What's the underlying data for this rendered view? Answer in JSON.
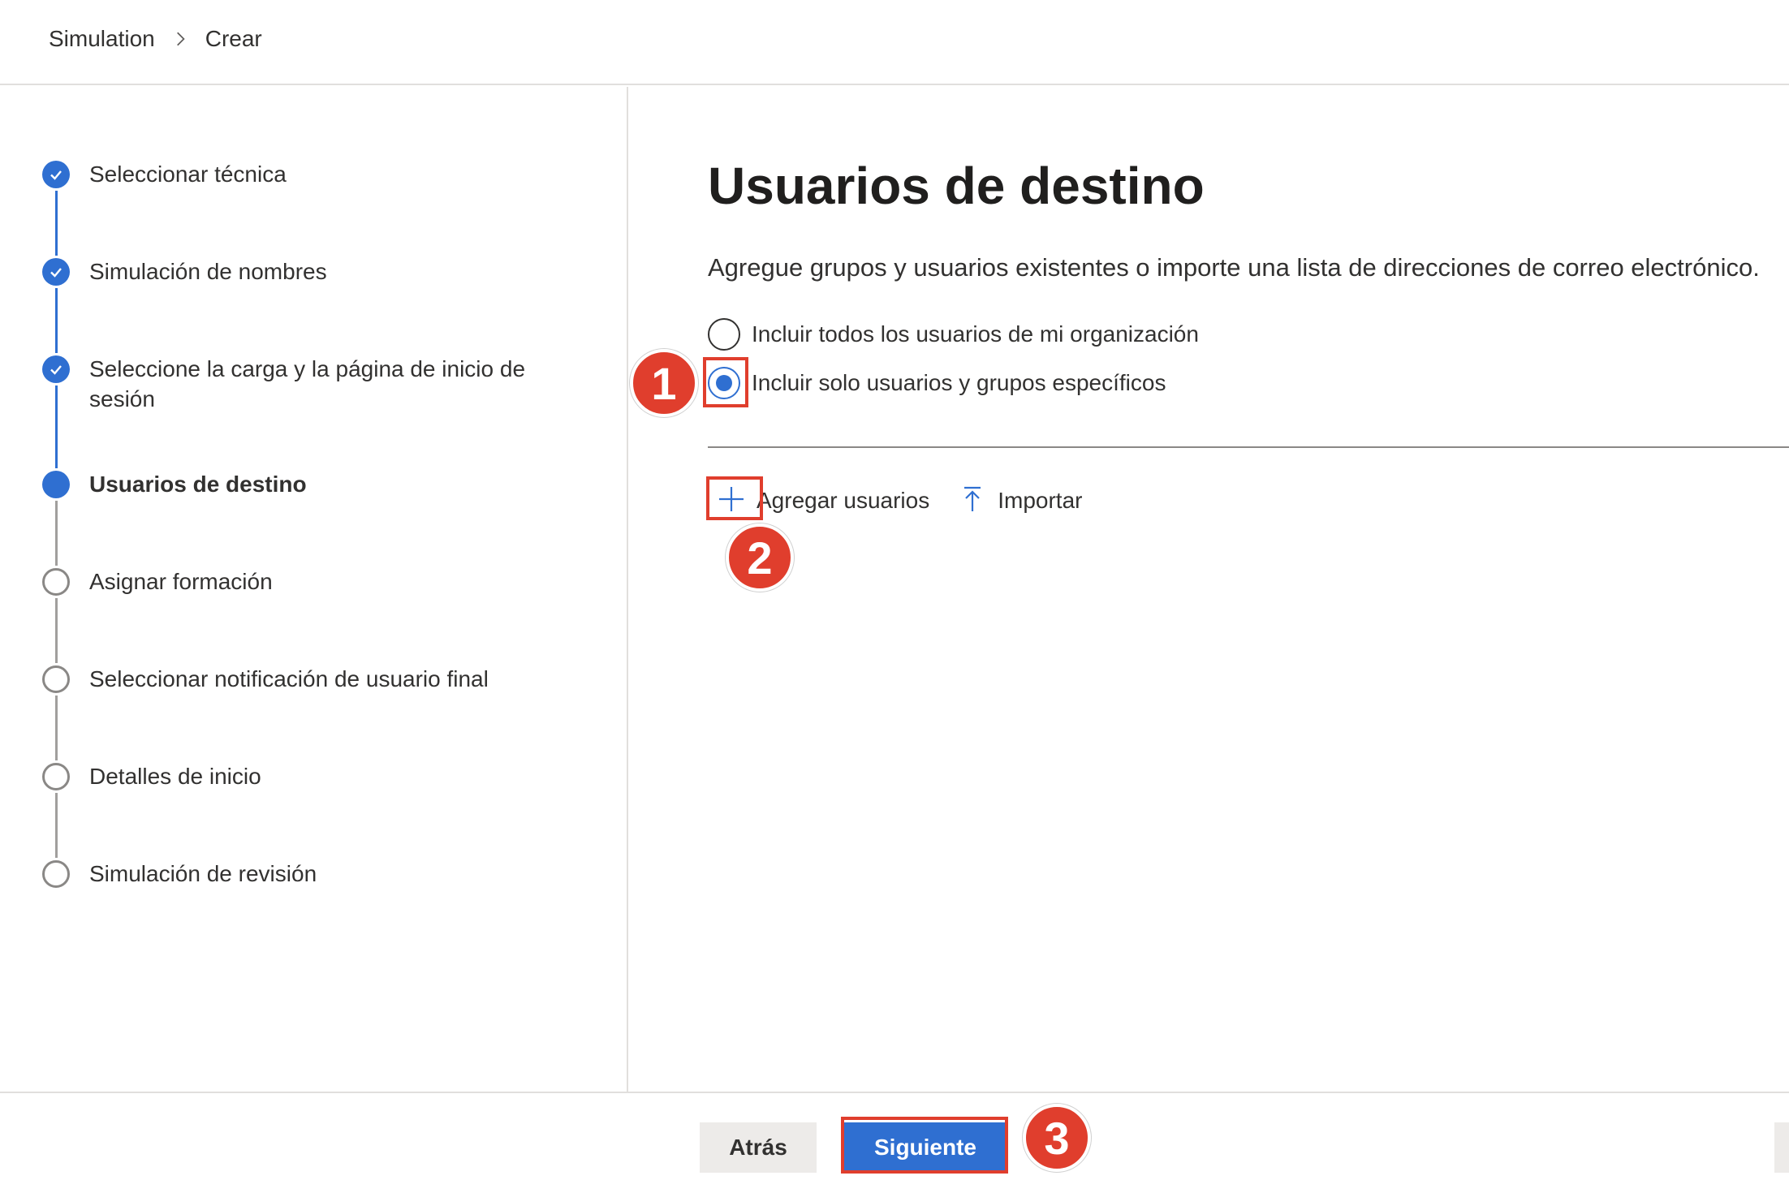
{
  "breadcrumb": {
    "items": [
      "Simulation",
      "Crear"
    ]
  },
  "wizard": {
    "steps": [
      {
        "label": "Seleccionar técnica",
        "state": "done"
      },
      {
        "label": "Simulación de nombres",
        "state": "done"
      },
      {
        "label": "Seleccione la carga y la página de inicio de sesión",
        "state": "done"
      },
      {
        "label": "Usuarios de destino",
        "state": "current"
      },
      {
        "label": "Asignar formación",
        "state": "pending"
      },
      {
        "label": "Seleccionar notificación de usuario final",
        "state": "pending"
      },
      {
        "label": "Detalles de inicio",
        "state": "pending"
      },
      {
        "label": "Simulación de revisión",
        "state": "pending"
      }
    ]
  },
  "main": {
    "title": "Usuarios de destino",
    "subtitle": "Agregue grupos y usuarios existentes o importe una lista de direcciones de correo electrónico.",
    "options": [
      {
        "label": "Incluir todos los usuarios de mi organización",
        "selected": false
      },
      {
        "label": "Incluir solo usuarios y grupos específicos",
        "selected": true
      }
    ],
    "commands": {
      "add_users": "Agregar usuarios",
      "import": "Importar"
    }
  },
  "footer": {
    "back": "Atrás",
    "next": "Siguiente"
  },
  "annotations": {
    "badge1": "1",
    "badge2": "2",
    "badge3": "3"
  },
  "colors": {
    "accent": "#2f6fd1",
    "annotation": "#e03e2d"
  }
}
